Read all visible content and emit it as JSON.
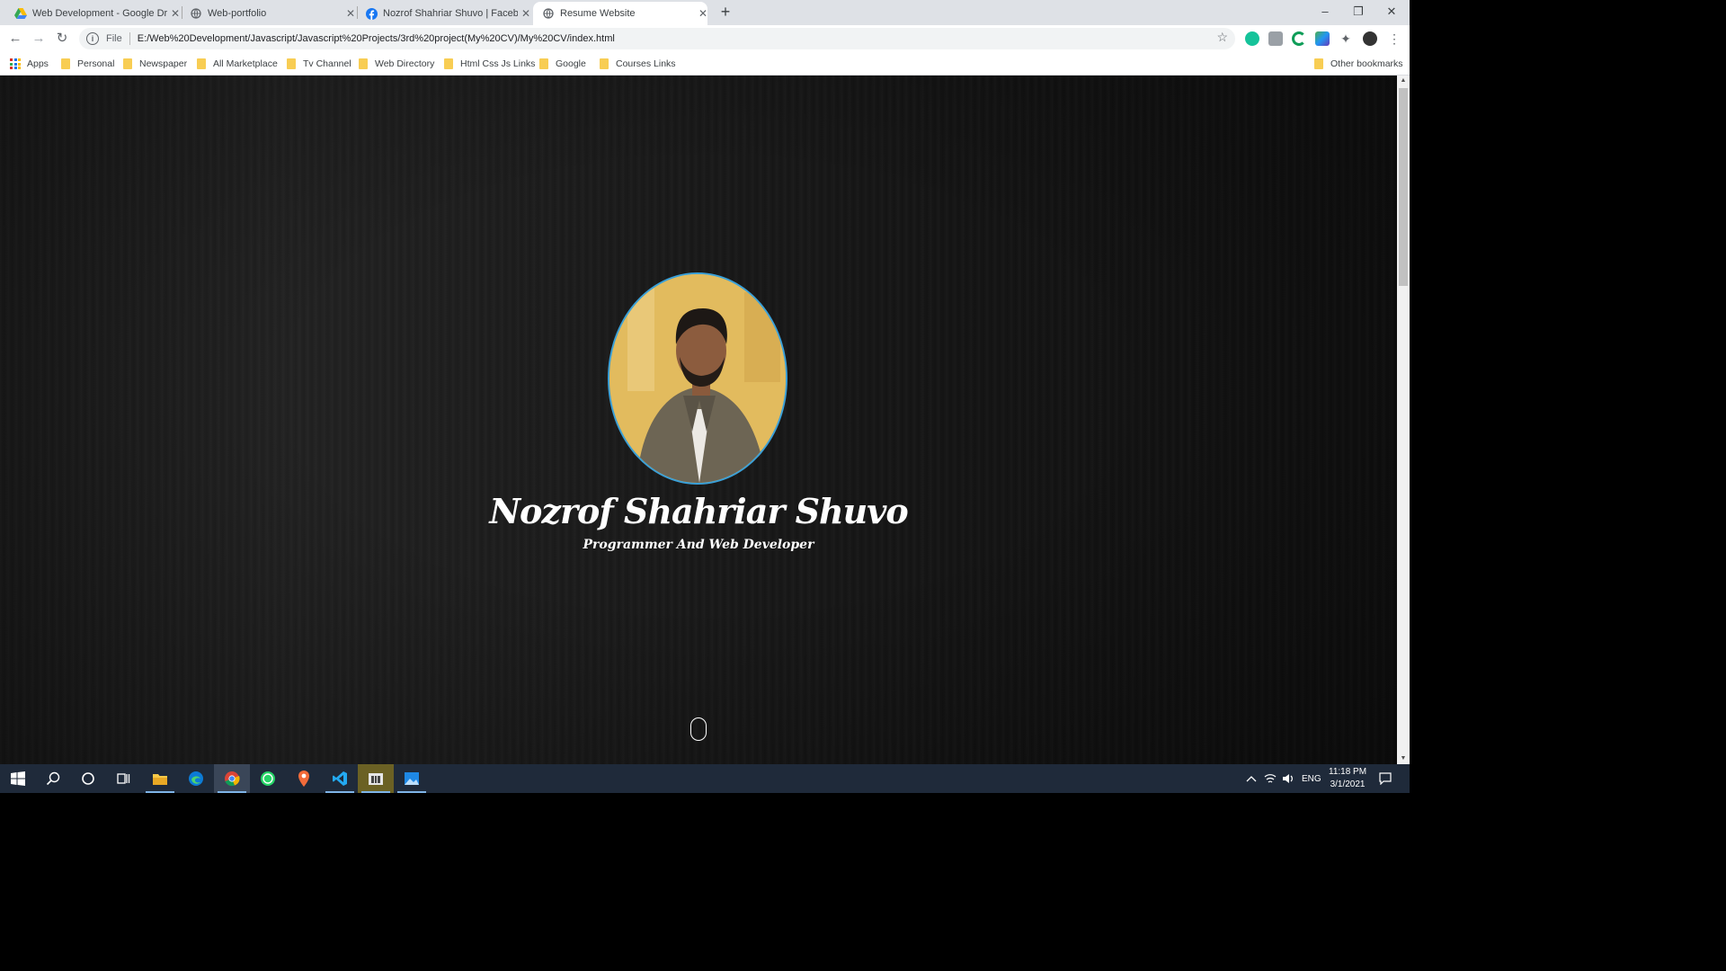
{
  "browser": {
    "tabs": [
      {
        "title": "Web Development - Google Driv",
        "icon": "google-drive-icon"
      },
      {
        "title": "Web-portfolio",
        "icon": "globe-icon"
      },
      {
        "title": "Nozrof Shahriar Shuvo | Faceboo",
        "icon": "facebook-icon"
      },
      {
        "title": "Resume Website",
        "icon": "globe-icon",
        "active": true
      }
    ],
    "address": {
      "scheme": "File",
      "url": "E:/Web%20Development/Javascript/Javascript%20Projects/3rd%20project(My%20CV)/My%20CV/index.html"
    },
    "bookmarks": [
      "Apps",
      "Personal",
      "Newspaper",
      "All Marketplace",
      "Tv Channel",
      "Web Directory",
      "Html Css Js Links",
      "Google",
      "Courses Links"
    ],
    "other_bookmarks": "Other bookmarks"
  },
  "page": {
    "name": "Nozrof Shahriar Shuvo",
    "role": "Programmer And Web Developer",
    "accent_color": "#3aa0d8"
  },
  "taskbar": {
    "apps": [
      "start-icon",
      "search-icon",
      "cortana-icon",
      "task-view-icon",
      "file-explorer-icon",
      "edge-icon",
      "chrome-icon",
      "whatsapp-icon",
      "maps-icon",
      "vscode-icon",
      "app-icon",
      "photos-icon"
    ],
    "language": "ENG",
    "time": "11:18 PM",
    "date": "3/1/2021"
  }
}
